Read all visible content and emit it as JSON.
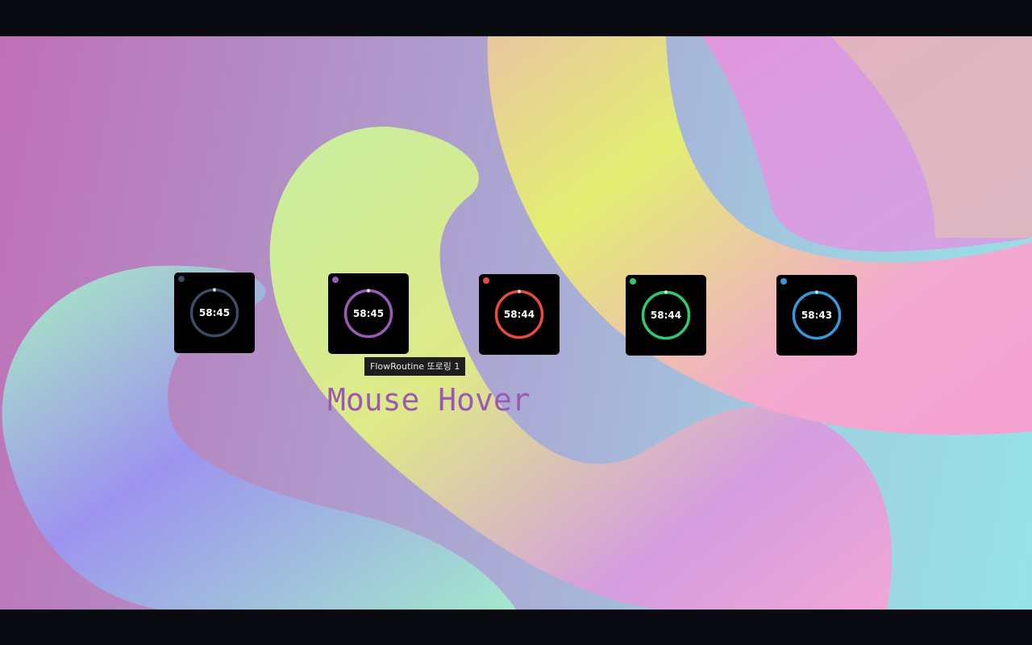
{
  "widgets": [
    {
      "time": "58:45",
      "color": "#3b4b63"
    },
    {
      "time": "58:45",
      "color": "#9b59b6"
    },
    {
      "time": "58:44",
      "color": "#e74c3c"
    },
    {
      "time": "58:44",
      "color": "#2ecc71"
    },
    {
      "time": "58:43",
      "color": "#3498db"
    }
  ],
  "tooltip": {
    "text": "FlowRoutine 또로링 1"
  },
  "caption": {
    "text": "Mouse Hover",
    "color": "#9b59b6"
  },
  "colors": {
    "letterbox": "#080a0f",
    "widget_bg": "#000000",
    "tooltip_bg": "#1e1e1e"
  }
}
